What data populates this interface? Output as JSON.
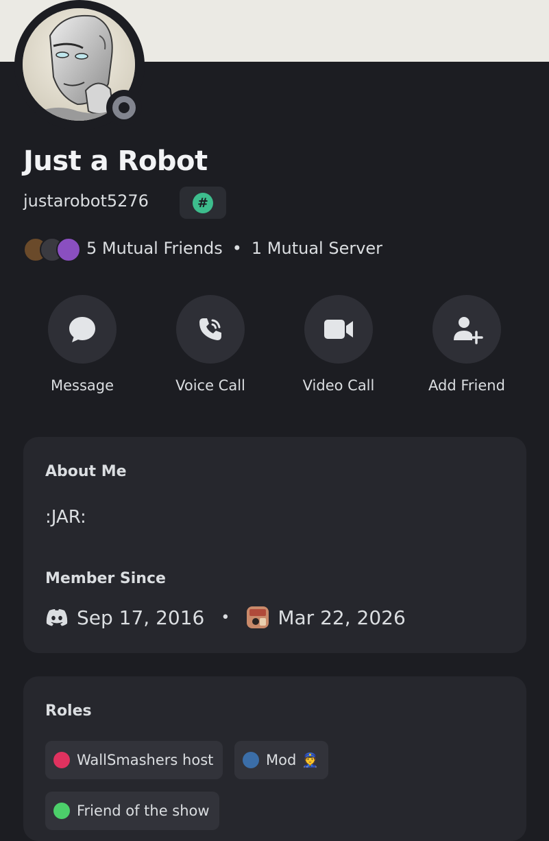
{
  "profile": {
    "display_name": "Just a Robot",
    "username": "justarobot5276",
    "tag_icon": "#",
    "status": "offline"
  },
  "mutuals": {
    "friends": "5 Mutual Friends",
    "separator": "•",
    "servers": "1 Mutual Server"
  },
  "actions": [
    {
      "label": "Message",
      "icon": "chat-bubble-icon"
    },
    {
      "label": "Voice Call",
      "icon": "phone-icon"
    },
    {
      "label": "Video Call",
      "icon": "video-camera-icon"
    },
    {
      "label": "Add Friend",
      "icon": "add-friend-icon"
    }
  ],
  "about": {
    "title": "About Me",
    "text": ":JAR:"
  },
  "member_since": {
    "title": "Member Since",
    "discord_date": "Sep 17, 2016",
    "separator": "•",
    "server_date": "Mar 22, 2026"
  },
  "roles": {
    "title": "Roles",
    "items": [
      {
        "name": "WallSmashers host",
        "color": "#e0325f"
      },
      {
        "name": "Mod",
        "color": "#3b6ea8",
        "emoji": "👮"
      },
      {
        "name": "Friend of the show",
        "color": "#4ccf6a"
      }
    ]
  },
  "colors": {
    "background": "#1c1d22",
    "card": "#26272d",
    "banner": "#ebeae4",
    "tag_green": "#3dbd8d"
  }
}
